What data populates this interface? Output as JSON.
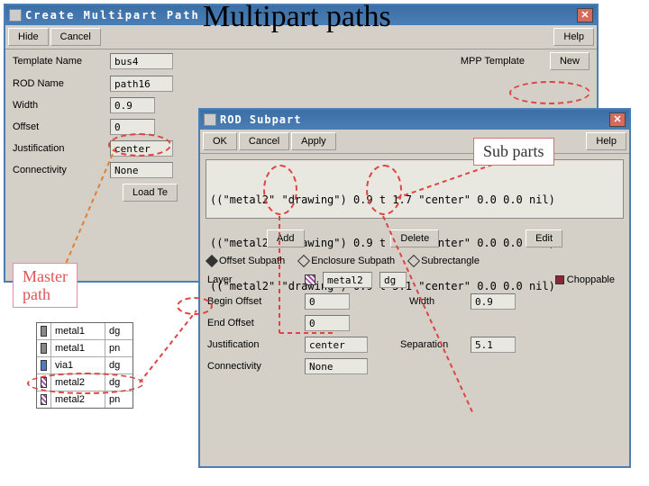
{
  "annotations": {
    "title": "Multipart paths",
    "subparts_label": "Sub parts",
    "masterpath_label": "Master path"
  },
  "win1": {
    "title": "Create Multipart Path",
    "buttons": {
      "hide": "Hide",
      "cancel": "Cancel",
      "help": "Help"
    },
    "labels": {
      "template_name": "Template Name",
      "rod_name": "ROD Name",
      "width": "Width",
      "offset": "Offset",
      "justification": "Justification",
      "connectivity": "Connectivity",
      "mpp_template": "MPP Template",
      "new": "New",
      "load_template": "Load Te"
    },
    "values": {
      "template_name": "bus4",
      "rod_name": "path16",
      "width": "0.9",
      "offset": "0",
      "justification": "center",
      "connectivity": "None"
    }
  },
  "win2": {
    "title": "ROD Subpart",
    "buttons": {
      "ok": "OK",
      "cancel": "Cancel",
      "apply": "Apply",
      "help": "Help",
      "add": "Add",
      "delete": "Delete",
      "edit": "Edit"
    },
    "list": [
      "((\"metal2\" \"drawing\") 0.9 t 1.7 \"center\" 0.0 0.0 nil)",
      "((\"metal2\" \"drawing\") 0.9 t 3.4 \"center\" 0.0 0.0 nil)",
      "((\"metal2\" \"drawing\") 0.9 t 5.1 \"center\" 0.0 0.0 nil)"
    ],
    "radios": {
      "offset_subpath": "Offset Subpath",
      "enclosure_subpath": "Enclosure Subpath",
      "subrectangle": "Subrectangle",
      "choppable": "Choppable"
    },
    "labels": {
      "layer": "Layer",
      "begin_offset": "Begin Offset",
      "end_offset": "End Offset",
      "width": "Width",
      "justification": "Justification",
      "separation": "Separation",
      "connectivity": "Connectivity"
    },
    "values": {
      "layer": "metal2",
      "layer_purpose": "dg",
      "begin_offset": "0",
      "end_offset": "0",
      "width": "0.9",
      "justification": "center",
      "separation": "5.1",
      "connectivity": "None"
    }
  },
  "table": {
    "rows": [
      {
        "layer": "metal1",
        "purpose": "dg",
        "swatch": "gray"
      },
      {
        "layer": "metal1",
        "purpose": "pn",
        "swatch": "gray"
      },
      {
        "layer": "via1",
        "purpose": "dg",
        "swatch": "blue"
      },
      {
        "layer": "metal2",
        "purpose": "dg",
        "swatch": "striped"
      },
      {
        "layer": "metal2",
        "purpose": "pn",
        "swatch": "striped"
      }
    ]
  }
}
